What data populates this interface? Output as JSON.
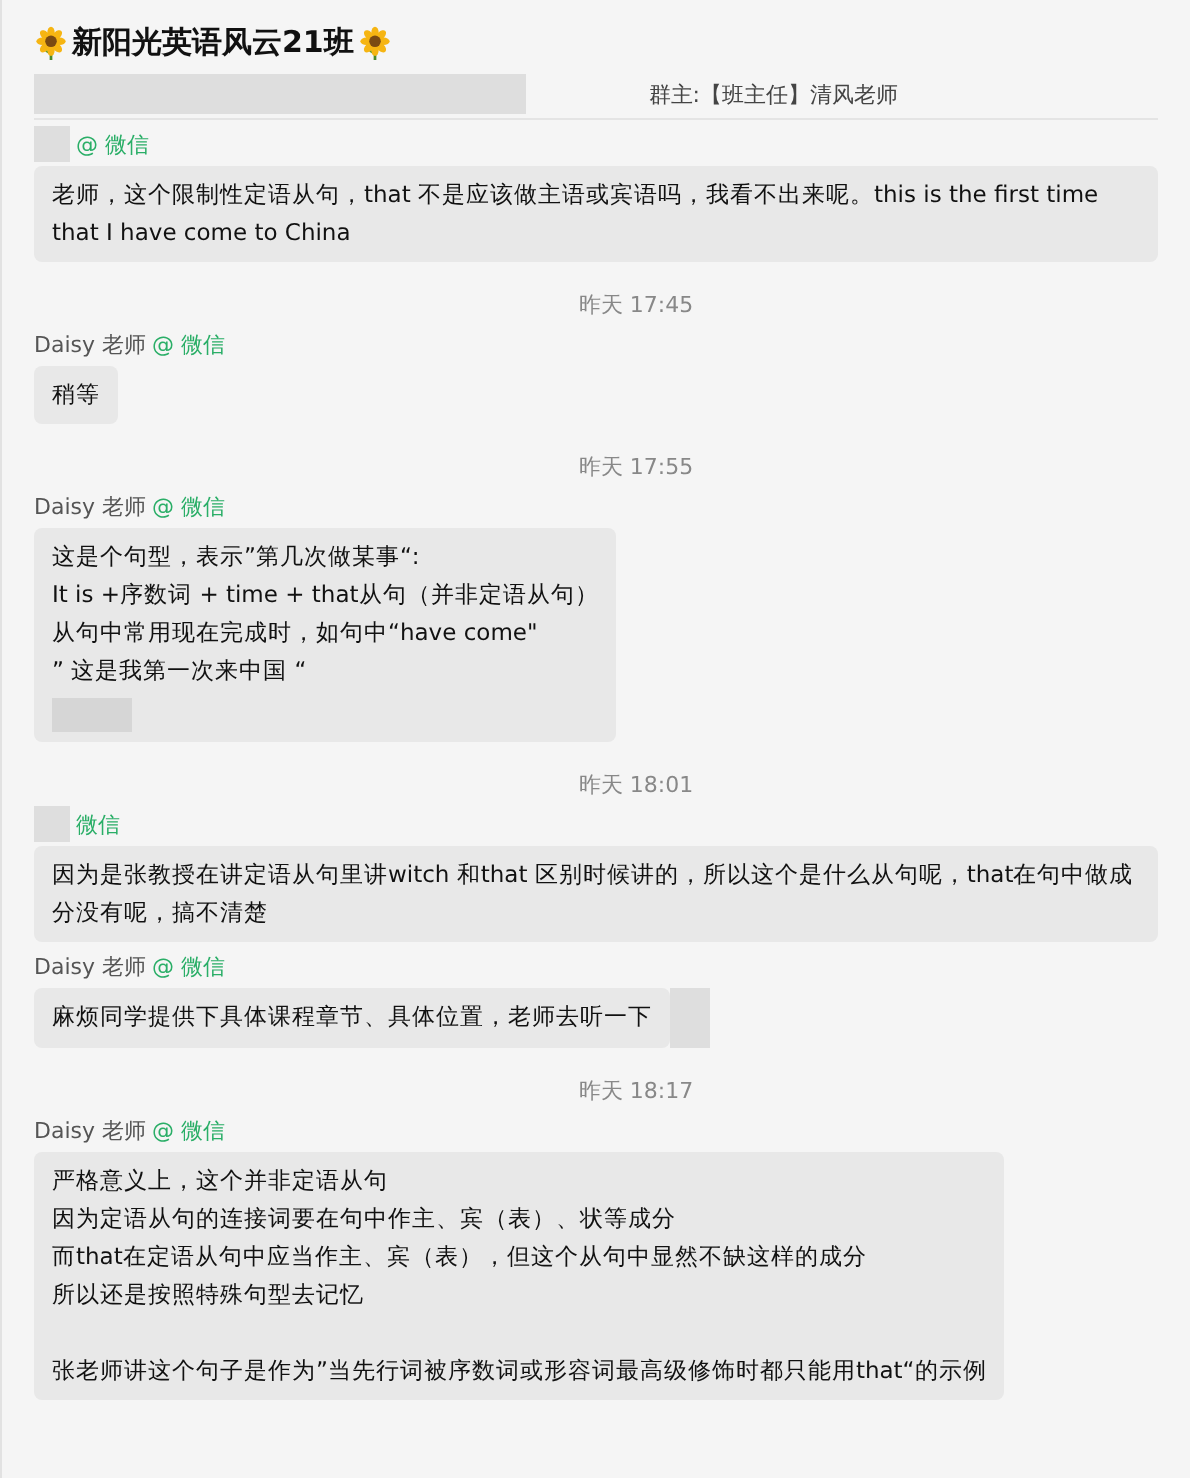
{
  "header": {
    "title": "新阳光英语风云21班",
    "owner": "群主:【班主任】清风老师",
    "owner_redacted": true
  },
  "messages": [
    {
      "kind": "message",
      "sender_redacted": true,
      "source": "@ 微信",
      "lines": [
        "老师，这个限制性定语从句，that 不是应该做主语或宾语吗，我看不出来呢。this is the first time that I have come to China"
      ]
    },
    {
      "kind": "time",
      "text": "昨天 17:45"
    },
    {
      "kind": "message",
      "sender": "Daisy 老师",
      "source": "@ 微信",
      "lines": [
        "稍等"
      ]
    },
    {
      "kind": "time",
      "text": "昨天 17:55"
    },
    {
      "kind": "message",
      "sender": "Daisy 老师",
      "source": "@ 微信",
      "lines": [
        "这是个句型，表示”第几次做某事“:",
        "It is +序数词 + time + that从句（并非定语从句）",
        "从句中常用现在完成时，如句中“have come\"",
        "” 这是我第一次来中国 “"
      ],
      "attachment_redacted": true
    },
    {
      "kind": "time",
      "text": "昨天 18:01"
    },
    {
      "kind": "message",
      "sender_redacted": true,
      "source": "微信",
      "lines": [
        "因为是张教授在讲定语从句里讲witch 和that 区别时候讲的，所以这个是什么从句呢，that在句中做成分没有呢，搞不清楚"
      ]
    },
    {
      "kind": "message",
      "sender": "Daisy 老师",
      "source": "@ 微信",
      "lines": [
        "麻烦同学提供下具体课程章节、具体位置，老师去听一下"
      ],
      "trailing_redacted": true
    },
    {
      "kind": "time",
      "text": "昨天 18:17"
    },
    {
      "kind": "message",
      "sender": "Daisy 老师",
      "source": "@ 微信",
      "lines": [
        "严格意义上，这个并非定语从句",
        "因为定语从句的连接词要在句中作主、宾（表）、状等成分",
        "而that在定语从句中应当作主、宾（表），但这个从句中显然不缺这样的成分",
        "所以还是按照特殊句型去记忆",
        {
          "kind": "blank"
        },
        "张老师讲这个句子是作为”当先行词被序数词或形容词最高级修饰时都只能用that“的示例"
      ]
    }
  ]
}
